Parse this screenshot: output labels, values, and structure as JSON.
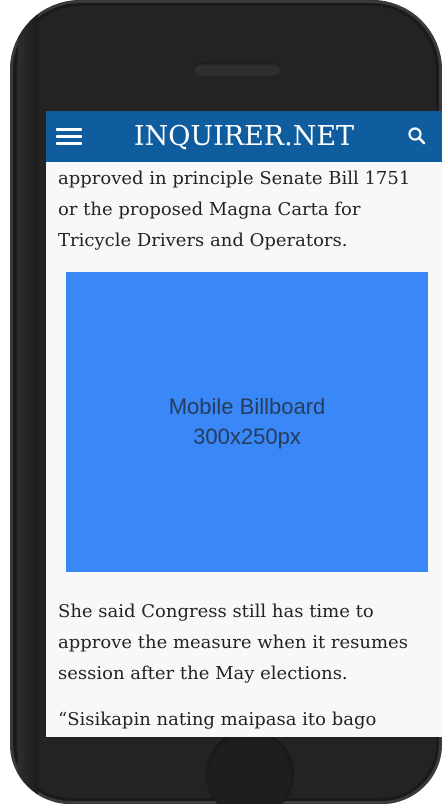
{
  "header": {
    "brand": "INQUIRER.NET",
    "menu_icon": "hamburger-menu-icon",
    "search_icon": "search-icon",
    "background": "#0f5d9e"
  },
  "article": {
    "paragraph_1": "approved in principle Senate Bill 1751 or the proposed Magna Carta for Tricycle Drivers and Operators.",
    "paragraph_2": "She said Congress still has time to approve the measure when it resumes session after the May elections.",
    "paragraph_3": "“Sisikapin nating maipasa ito bago"
  },
  "ad": {
    "line_1": "Mobile Billboard",
    "line_2": "300x250px",
    "background": "#3a87f7"
  }
}
